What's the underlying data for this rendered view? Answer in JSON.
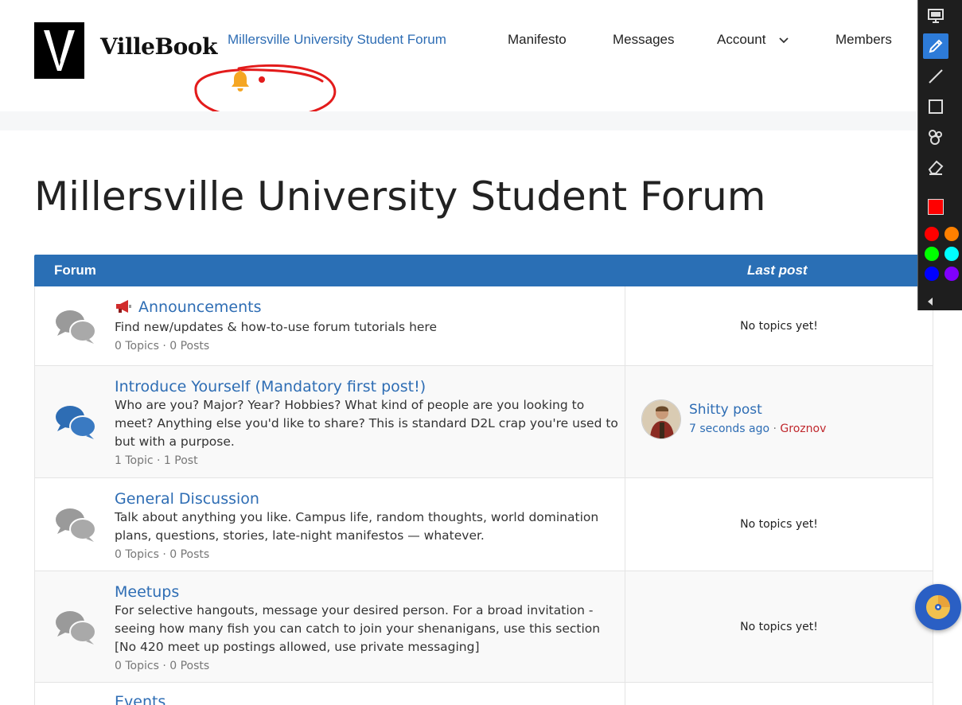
{
  "header": {
    "logo_letter": "V",
    "brand": "VilleBook",
    "nav": [
      {
        "label": "Millersville University Student Forum"
      },
      {
        "label": "Manifesto"
      },
      {
        "label": "Messages"
      },
      {
        "label": "Account"
      },
      {
        "label": "Members"
      }
    ],
    "notification_icon": "bell-icon"
  },
  "page": {
    "title": "Millersville University Student Forum"
  },
  "table": {
    "col_forum": "Forum",
    "col_last_post": "Last post",
    "rows": [
      {
        "title": "Announcements",
        "icon": "megaphone-icon",
        "description": "Find new/updates & how-to-use forum tutorials here",
        "stats": "0 Topics · 0 Posts",
        "last_post": "No topics yet!"
      },
      {
        "title": "Introduce Yourself (Mandatory first post!)",
        "description": "Who are you? Major? Year? Hobbies? What kind of people are you looking to meet? Anything else you'd like to share? This is standard D2L crap you're used to but with a purpose.",
        "stats": "1 Topic · 1 Post",
        "last_post_title": "Shitty post",
        "last_post_time": "7 seconds ago",
        "last_post_sep": "·",
        "last_post_user": "Groznov"
      },
      {
        "title": "General Discussion",
        "description": "Talk about anything you like. Campus life, random thoughts, world domination plans, questions, stories, late-night manifestos — whatever.",
        "stats": "0 Topics · 0 Posts",
        "last_post": "No topics yet!"
      },
      {
        "title": "Meetups",
        "description": "For selective hangouts, message your desired person. For a broad invitation - seeing how many fish you can catch to join your shenanigans, use this section [No 420 meet up postings allowed, use private messaging]",
        "stats": "0 Topics · 0 Posts",
        "last_post": "No topics yet!"
      },
      {
        "title": "Events"
      }
    ]
  },
  "colors": {
    "accent": "#2a6fb5",
    "link": "#2e6db4",
    "user": "#c0282d",
    "bell": "#f5a623",
    "annotation": "#e31b1b"
  },
  "toolbar": {
    "tools": [
      "screen-icon",
      "pencil-icon",
      "line-icon",
      "rectangle-icon",
      "stamp-icon",
      "eraser-icon"
    ],
    "swatches": [
      "#ff0000",
      "#ff8000",
      "#00ff00",
      "#00ffff",
      "#0000ff",
      "#8000ff"
    ]
  }
}
